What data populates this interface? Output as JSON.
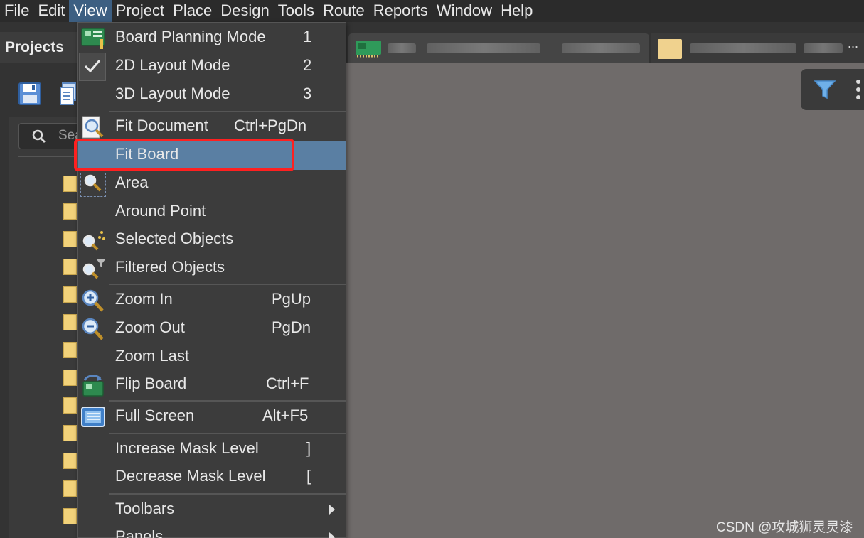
{
  "menubar": {
    "items": [
      "File",
      "Edit",
      "View",
      "Project",
      "Place",
      "Design",
      "Tools",
      "Route",
      "Reports",
      "Window",
      "Help"
    ],
    "active_index": 2
  },
  "projects_panel": {
    "title": "Projects",
    "search_placeholder": "Sea"
  },
  "document_tabs": {
    "more": "..."
  },
  "view_menu": {
    "items": [
      {
        "label": "Board Planning Mode",
        "shortcut": "1",
        "icon": "board-planning-icon"
      },
      {
        "label": "2D Layout Mode",
        "shortcut": "2",
        "icon": "checkmark-icon",
        "checked": true
      },
      {
        "label": "3D Layout Mode",
        "shortcut": "3"
      },
      {
        "label": "Fit Document",
        "shortcut": "Ctrl+PgDn",
        "icon": "fit-document-icon"
      },
      {
        "label": "Fit Board",
        "shortcut": "",
        "selected": true
      },
      {
        "label": "Area",
        "shortcut": "",
        "icon": "zoom-area-icon"
      },
      {
        "label": "Around Point",
        "shortcut": ""
      },
      {
        "label": "Selected Objects",
        "shortcut": "",
        "icon": "zoom-selected-icon"
      },
      {
        "label": "Filtered Objects",
        "shortcut": "",
        "icon": "zoom-filtered-icon"
      },
      {
        "label": "Zoom In",
        "shortcut": "PgUp",
        "icon": "zoom-in-icon"
      },
      {
        "label": "Zoom Out",
        "shortcut": "PgDn",
        "icon": "zoom-out-icon"
      },
      {
        "label": "Zoom Last",
        "shortcut": ""
      },
      {
        "label": "Flip Board",
        "shortcut": "Ctrl+F",
        "icon": "flip-board-icon"
      },
      {
        "label": "Full Screen",
        "shortcut": "Alt+F5",
        "icon": "full-screen-icon"
      },
      {
        "label": "Increase Mask Level",
        "shortcut": "]"
      },
      {
        "label": "Decrease Mask Level",
        "shortcut": "["
      },
      {
        "label": "Toolbars",
        "shortcut": "",
        "submenu": true
      },
      {
        "label": "Panels",
        "shortcut": "",
        "submenu": true
      }
    ]
  },
  "watermark": "CSDN @攻城狮灵灵漆",
  "colors": {
    "menubar_bg": "#2b2b2b",
    "menu_bg": "#3c3c3c",
    "selected_bg": "#5a7fa3",
    "canvas_bg": "#6f6b6a",
    "highlight_border": "#ff2020"
  }
}
